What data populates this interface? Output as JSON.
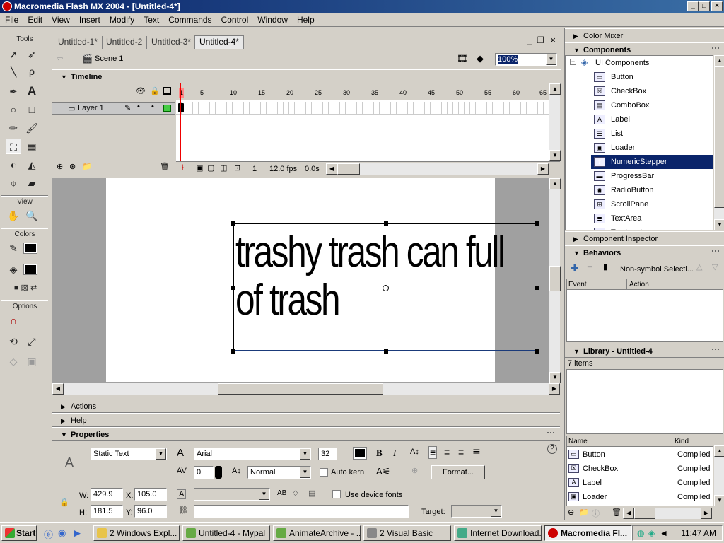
{
  "window": {
    "title": "Macromedia Flash MX 2004 - [Untitled-4*]",
    "minimize": "_",
    "restore": "□",
    "close": "×"
  },
  "menu": [
    "File",
    "Edit",
    "View",
    "Insert",
    "Modify",
    "Text",
    "Commands",
    "Control",
    "Window",
    "Help"
  ],
  "tools": {
    "header": "Tools",
    "view": "View",
    "colors": "Colors",
    "options": "Options"
  },
  "tabs": [
    "Untitled-1*",
    "Untitled-2",
    "Untitled-3*",
    "Untitled-4*"
  ],
  "scene": {
    "label": "Scene 1",
    "zoom": "100%"
  },
  "timeline": {
    "title": "Timeline",
    "layer": "Layer 1",
    "frame_numbers": [
      "1",
      "5",
      "10",
      "15",
      "20",
      "25",
      "30",
      "35",
      "40",
      "45",
      "50",
      "55",
      "60",
      "65"
    ],
    "current_frame": "1",
    "fps": "12.0 fps",
    "time": "0.0s"
  },
  "stage": {
    "text_line1": "trashy trash can full",
    "text_line2": "of trash"
  },
  "panels": {
    "actions": "Actions",
    "help": "Help",
    "properties": "Properties"
  },
  "properties": {
    "text_type": "Static Text",
    "font": "Arial",
    "size": "32",
    "bold": "B",
    "italic": "I",
    "tracking": "0",
    "baseline": "Normal",
    "auto_kern": "Auto kern",
    "format_button": "Format...",
    "w_label": "W:",
    "w": "429.9",
    "x_label": "X:",
    "x": "105.0",
    "h_label": "H:",
    "h": "181.5",
    "y_label": "Y:",
    "y": "96.0",
    "use_device_fonts": "Use device fonts",
    "target_label": "Target:"
  },
  "right": {
    "color_mixer": "Color Mixer",
    "components": "Components",
    "ui_components": "UI Components",
    "component_items": [
      "Button",
      "CheckBox",
      "ComboBox",
      "Label",
      "List",
      "Loader",
      "NumericStepper",
      "ProgressBar",
      "RadioButton",
      "ScrollPane",
      "TextArea",
      "TextInput"
    ],
    "selected_component": "NumericStepper",
    "component_inspector": "Component Inspector",
    "behaviors": "Behaviors",
    "behaviors_target": "Non-symbol Selecti...",
    "event_col": "Event",
    "action_col": "Action",
    "library": "Library - Untitled-4",
    "library_count": "7 items",
    "lib_name_col": "Name",
    "lib_kind_col": "Kind",
    "library_items": [
      {
        "name": "Button",
        "kind": "Compiled C"
      },
      {
        "name": "CheckBox",
        "kind": "Compiled C"
      },
      {
        "name": "Label",
        "kind": "Compiled C"
      },
      {
        "name": "Loader",
        "kind": "Compiled C"
      }
    ]
  },
  "taskbar": {
    "start": "Start",
    "tasks": [
      "2 Windows Expl...",
      "Untitled-4 - Mypal",
      "AnimateArchive - ...",
      "2 Visual Basic",
      "Internet Download...",
      "Macromedia Fl..."
    ],
    "time": "11:47 AM"
  }
}
